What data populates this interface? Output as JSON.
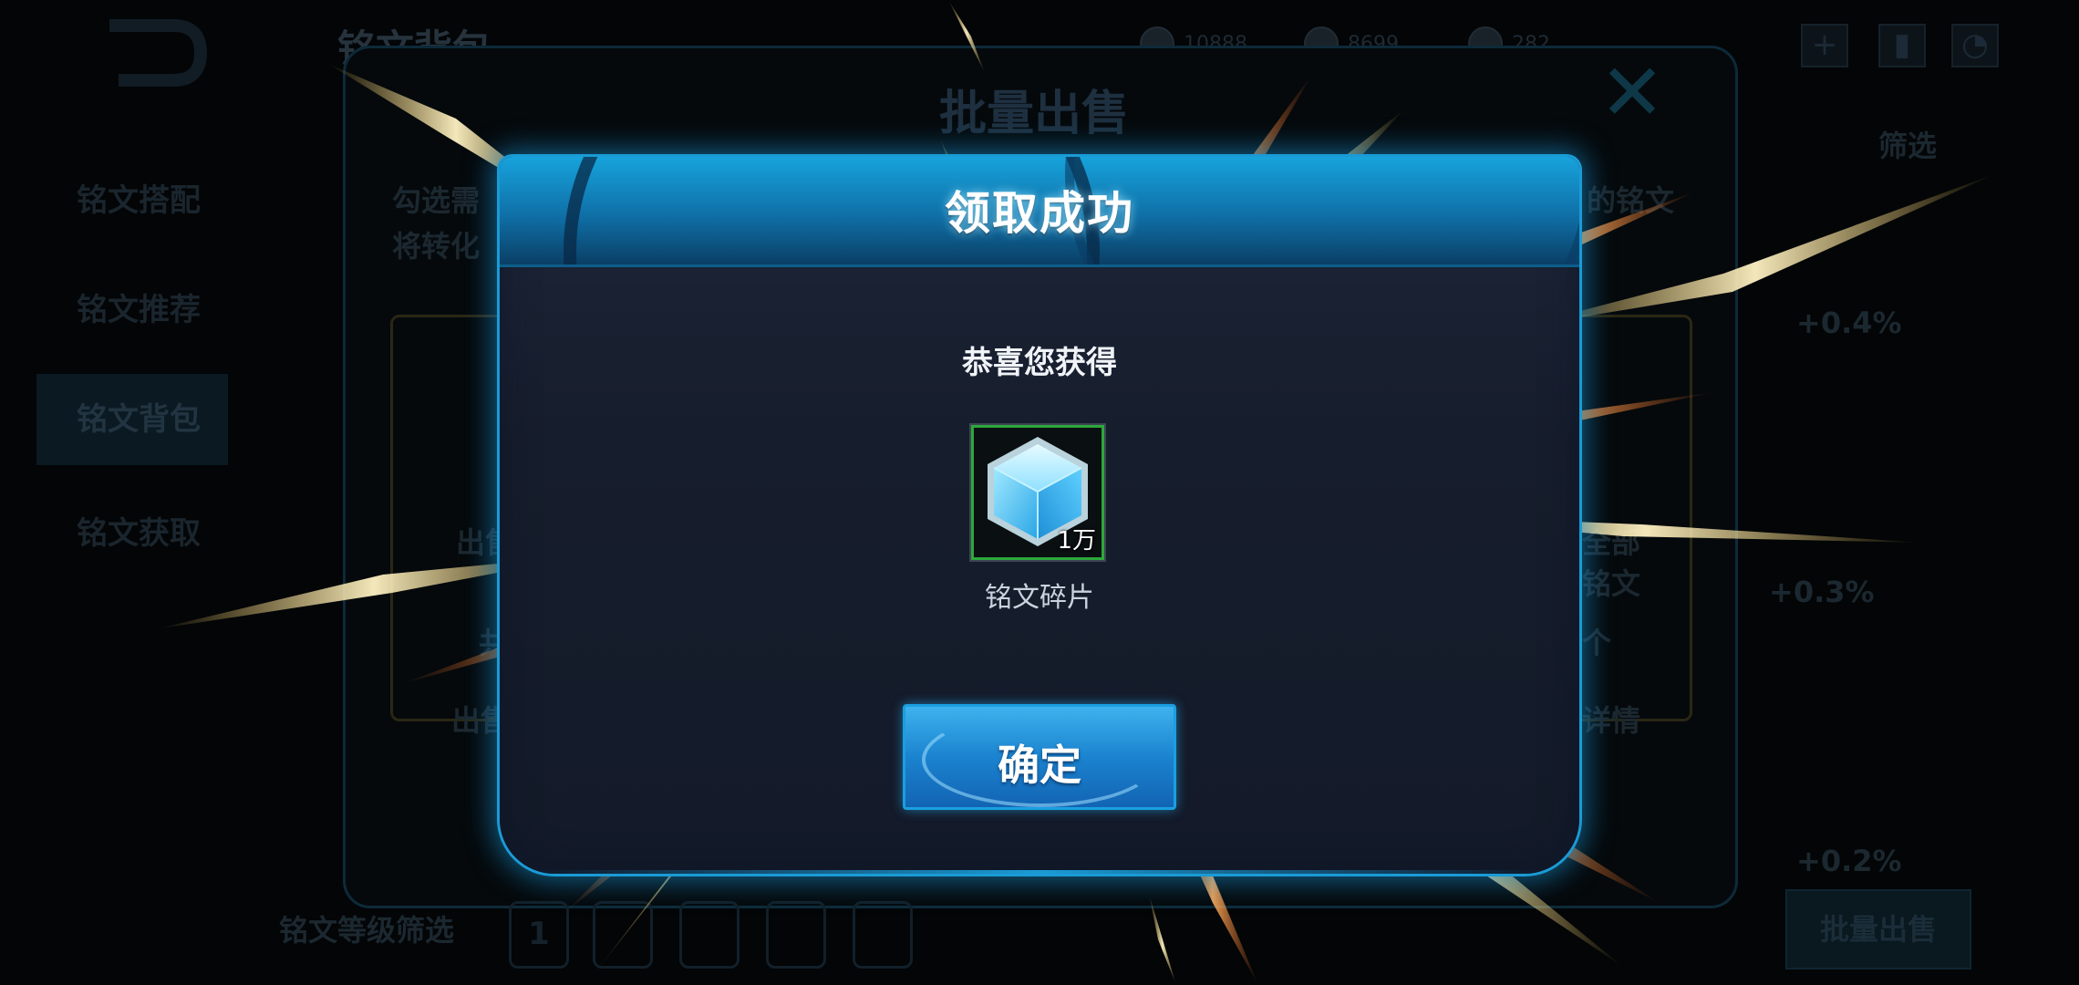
{
  "background": {
    "page_title": "铭文背包",
    "currencies": [
      "10888",
      "8699",
      "282"
    ],
    "sidebar": [
      "铭文搭配",
      "铭文推荐",
      "铭文背包",
      "铭文获取"
    ],
    "batch_title": "批量出售",
    "hint_line1": "勾选需",
    "hint_line2": "将转化",
    "hint_right": "的铭文",
    "left_card_a": "出售",
    "left_card_b": "共",
    "left_card_tab": "出售",
    "right_card_a": "全部",
    "right_card_b": "铭文",
    "right_card_c": "个",
    "right_card_tab": "详情",
    "right_stat_1": "+0.4%",
    "right_stat_2": "+0.3%",
    "right_stat_3": "+0.2%",
    "right_top": "筛选",
    "filter_label": "铭文等级筛选",
    "filter_first": "1",
    "sell_button": "批量出售"
  },
  "dialog": {
    "title": "领取成功",
    "congrats": "恭喜您获得",
    "item": {
      "name": "铭文碎片",
      "count": "1万",
      "icon": "blue-crystal-cube-icon"
    },
    "confirm_label": "确定"
  },
  "colors": {
    "dialog_border": "#1a9bd6",
    "header_top": "#17a3dc",
    "button": "#1b83cf",
    "item_border": "#2da83a"
  }
}
